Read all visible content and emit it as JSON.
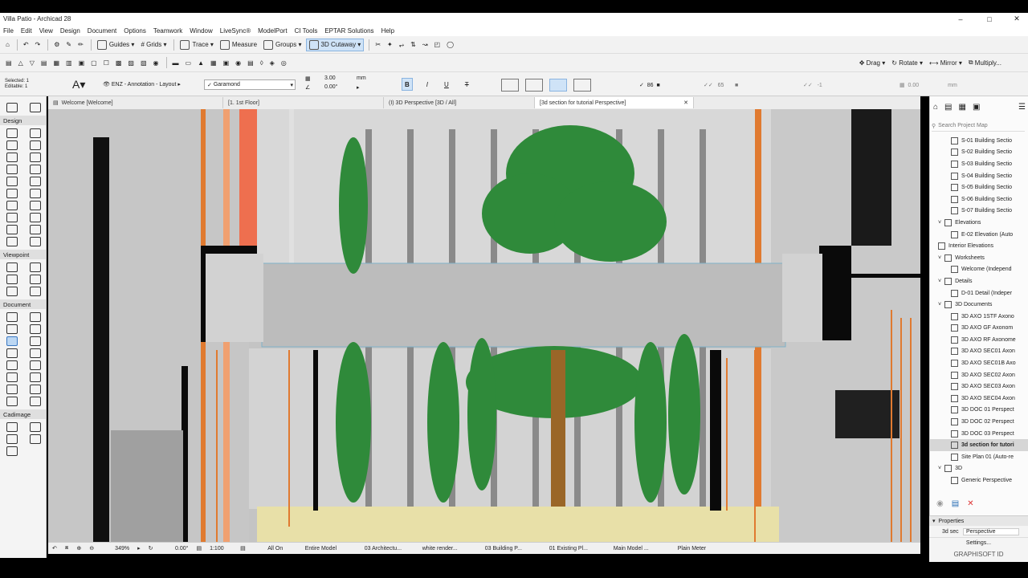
{
  "window": {
    "title": "Villa Patio - Archicad 28"
  },
  "menu": [
    "File",
    "Edit",
    "View",
    "Design",
    "Document",
    "Options",
    "Teamwork",
    "Window",
    "LiveSync®",
    "ModelPort",
    "CI Tools",
    "EPTAR Solutions",
    "Help"
  ],
  "toolbar1": {
    "guides": "Guides",
    "grids": "Grids",
    "trace": "Trace",
    "measure": "Measure",
    "groups": "Groups",
    "cutaway": "3D Cutaway"
  },
  "toolbar2": {
    "drag": "Drag",
    "rotate": "Rotate",
    "mirror": "Mirror",
    "multiply": "Multiply..."
  },
  "infobox": {
    "selected": "Selected: 1",
    "editable": "Editable: 1",
    "layer": "ENZ - Annotation - Layout",
    "font": "Garamond",
    "size": "3.00",
    "unit": "mm",
    "angle": "0.00°",
    "pen1": "86",
    "pen2": "65",
    "pen3": "-1",
    "dim": "0.00",
    "dim_unit": "mm"
  },
  "tabs": [
    "Welcome [Welcome]",
    "[1. 1st Floor]",
    "(I) 3D Perspective [3D / All]",
    "[3d section for tutorial Perspective]"
  ],
  "toolbox": {
    "design": "Design",
    "viewpoint": "Viewpoint",
    "document": "Document",
    "cadimage": "Cadimage"
  },
  "navigator": {
    "search_placeholder": "Search Project Map",
    "items": [
      {
        "label": "S-01 Building Sectio",
        "indent": 2
      },
      {
        "label": "S-02 Building Sectio",
        "indent": 2
      },
      {
        "label": "S-03 Building Sectio",
        "indent": 2
      },
      {
        "label": "S-04 Building Sectio",
        "indent": 2
      },
      {
        "label": "S-05 Building Sectio",
        "indent": 2
      },
      {
        "label": "S-06 Building Sectio",
        "indent": 2
      },
      {
        "label": "S-07 Building Sectio",
        "indent": 2
      },
      {
        "label": "Elevations",
        "indent": 1,
        "folder": true
      },
      {
        "label": "E-02 Elevation (Auto",
        "indent": 2
      },
      {
        "label": "Interior Elevations",
        "indent": 1
      },
      {
        "label": "Worksheets",
        "indent": 1,
        "folder": true
      },
      {
        "label": "Welcome (Independ",
        "indent": 2
      },
      {
        "label": "Details",
        "indent": 1,
        "folder": true
      },
      {
        "label": "D-01 Detail (Indeper",
        "indent": 2
      },
      {
        "label": "3D Documents",
        "indent": 1,
        "folder": true
      },
      {
        "label": "3D AXO 1STF Axono",
        "indent": 2
      },
      {
        "label": "3D AXO GF Axonom",
        "indent": 2
      },
      {
        "label": "3D AXO RF Axonome",
        "indent": 2
      },
      {
        "label": "3D AXO SEC01 Axon",
        "indent": 2
      },
      {
        "label": "3D AXO SEC01B Axo",
        "indent": 2
      },
      {
        "label": "3D AXO SEC02 Axon",
        "indent": 2
      },
      {
        "label": "3D AXO SEC03 Axon",
        "indent": 2
      },
      {
        "label": "3D AXO SEC04 Axon",
        "indent": 2
      },
      {
        "label": "3D DOC 01 Perspect",
        "indent": 2
      },
      {
        "label": "3D DOC 02 Perspect",
        "indent": 2
      },
      {
        "label": "3D DOC 03 Perspect",
        "indent": 2
      },
      {
        "label": "3d section for tutori",
        "indent": 2,
        "selected": true
      },
      {
        "label": "Site Plan 01 (Auto-re",
        "indent": 2
      },
      {
        "label": "3D",
        "indent": 1,
        "folder": true
      },
      {
        "label": "Generic Perspective",
        "indent": 2
      }
    ]
  },
  "properties": {
    "header": "Properties",
    "id": "3d sec",
    "value": "Perspective",
    "settings": "Settings...",
    "brand": "GRAPHISOFT ID"
  },
  "statusbar": {
    "zoom": "349%",
    "angle": "0.00°",
    "scale": "1:100",
    "layers": "All On",
    "model": "Entire Model",
    "pen": "03 Architectu...",
    "override": "white render...",
    "mvo": "03 Building P...",
    "reno": "01 Existing Pl...",
    "structure": "Main Model ...",
    "dim": "Plain Meter"
  }
}
